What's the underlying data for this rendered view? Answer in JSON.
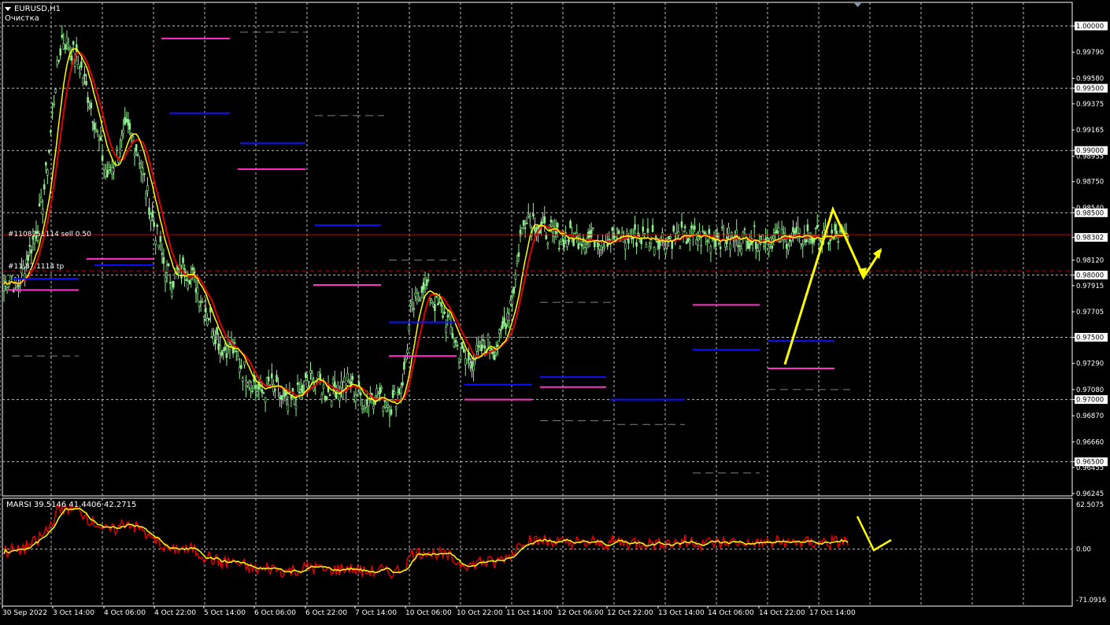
{
  "window": {
    "symbol_label": "EURUSD,H1",
    "script_label": "Очистка"
  },
  "order_labels": [
    "#1108751114 sell 0.50",
    "#11.87.1114 tp"
  ],
  "indicator": {
    "label": "MARSI 39.5146 41.4406 42.2715",
    "levels": [
      "62.5075",
      "0.00",
      "-71.0916"
    ]
  },
  "price_axis": {
    "ticks": [
      "1.00000",
      "0.99790",
      "0.99580",
      "0.99500",
      "0.99375",
      "0.99165",
      "0.99000",
      "0.98955",
      "0.98750",
      "0.98540",
      "0.98500",
      "0.98302",
      "0.98120",
      "0.98000",
      "0.97915",
      "0.97705",
      "0.97500",
      "0.97290",
      "0.97080",
      "0.97000",
      "0.96870",
      "0.96660",
      "0.96500",
      "0.96455",
      "0.96245"
    ],
    "highlighted": [
      "1.00000",
      "0.99500",
      "0.99000",
      "0.98500",
      "0.98302",
      "0.98000",
      "0.97500",
      "0.97000",
      "0.96500"
    ]
  },
  "time_axis": [
    "30 Sep 2022",
    "3 Oct 14:00",
    "4 Oct 06:00",
    "4 Oct 22:00",
    "5 Oct 14:00",
    "6 Oct 06:00",
    "6 Oct 22:00",
    "7 Oct 14:00",
    "10 Oct 06:00",
    "10 Oct 22:00",
    "11 Oct 14:00",
    "12 Oct 06:00",
    "12 Oct 22:00",
    "13 Oct 14:00",
    "14 Oct 06:00",
    "14 Oct 22:00",
    "17 Oct 14:00"
  ],
  "colors": {
    "background": "#000000",
    "grid": "#c0c0c0",
    "candles": "#90ee90",
    "ma_red": "#e00000",
    "ma_yellow": "#ffff00",
    "level_magenta": "#ff33cc",
    "level_blue": "#1010ff",
    "order_line": "#c00000"
  },
  "chart_data": {
    "type": "line",
    "series": [
      {
        "x": [
          0,
          2,
          4,
          6,
          8,
          10,
          12,
          14,
          16,
          18,
          20,
          22,
          24,
          26,
          28,
          30,
          32,
          34,
          36,
          38,
          40,
          42,
          44,
          46,
          48,
          50,
          52,
          54,
          56,
          58,
          60,
          62,
          64,
          66,
          68,
          70,
          72,
          74,
          76,
          78,
          80,
          82,
          84,
          86,
          88,
          90,
          92,
          94,
          96,
          98,
          100,
          102,
          104,
          106,
          108,
          110,
          112,
          114,
          116,
          118,
          120,
          122,
          124,
          126,
          128,
          130,
          132,
          134,
          136,
          138,
          140,
          142,
          144,
          146,
          148,
          150,
          152,
          154,
          156,
          158,
          160,
          162,
          164,
          166,
          168,
          170,
          172,
          174,
          176,
          178,
          180,
          182,
          184,
          186,
          188,
          190,
          192,
          194,
          196,
          198,
          200,
          202,
          204,
          206,
          208,
          210,
          212,
          214,
          216,
          218,
          220,
          222,
          224,
          226,
          228,
          230,
          232,
          234,
          236,
          238,
          240,
          242,
          244,
          246,
          248,
          250,
          252,
          254,
          256,
          258,
          260,
          262
        ],
        "y": [
          0.9793,
          0.98,
          0.9788,
          0.9805,
          0.982,
          0.9835,
          0.986,
          0.99,
          0.9955,
          0.999,
          0.9985,
          0.9975,
          0.9965,
          0.9945,
          0.9925,
          0.99,
          0.988,
          0.989,
          0.9905,
          0.9915,
          0.991,
          0.9895,
          0.987,
          0.9845,
          0.9825,
          0.9805,
          0.9795,
          0.98,
          0.9805,
          0.98,
          0.979,
          0.9775,
          0.9765,
          0.975,
          0.974,
          0.9745,
          0.9735,
          0.9725,
          0.972,
          0.971,
          0.9705,
          0.9712,
          0.9708,
          0.97,
          0.9695,
          0.9702,
          0.9705,
          0.9715,
          0.9718,
          0.9712,
          0.9705,
          0.9708,
          0.971,
          0.9715,
          0.971,
          0.9703,
          0.97,
          0.9703,
          0.9705,
          0.97,
          0.9695,
          0.9705,
          0.972,
          0.977,
          0.978,
          0.9795,
          0.9785,
          0.9775,
          0.977,
          0.976,
          0.9745,
          0.9735,
          0.973,
          0.9735,
          0.974,
          0.9745,
          0.974,
          0.975,
          0.977,
          0.979,
          0.983,
          0.985,
          0.9845,
          0.9835,
          0.9835,
          0.9833,
          0.983,
          0.983,
          0.983,
          0.983,
          0.983,
          0.983,
          0.983,
          0.983,
          0.983,
          0.983,
          0.983,
          0.983,
          0.983,
          0.983,
          0.983,
          0.983,
          0.983,
          0.983,
          0.983,
          0.983,
          0.983,
          0.983,
          0.983,
          0.983,
          0.983,
          0.983,
          0.983,
          0.983,
          0.983,
          0.983,
          0.983,
          0.983,
          0.983,
          0.983,
          0.983,
          0.983,
          0.983,
          0.983,
          0.983,
          0.983,
          0.983,
          0.983,
          0.983,
          0.983,
          0.983,
          0.983
        ]
      }
    ],
    "ylim": [
      0.96245,
      1.0
    ],
    "grid": true,
    "indicator_ylim": [
      -71.0916,
      62.5075
    ]
  }
}
